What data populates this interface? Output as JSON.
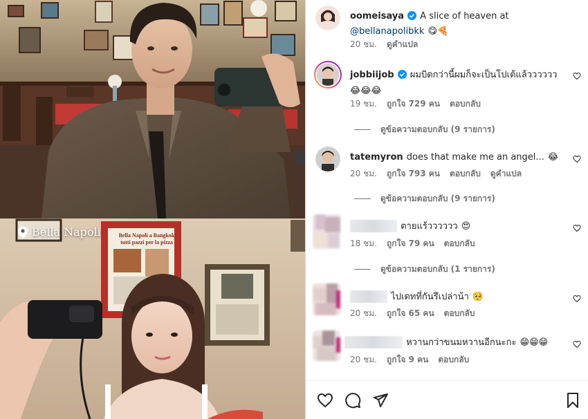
{
  "location": {
    "name": "Bella Napoli"
  },
  "poster_sign": {
    "line1": "Bella Napoli a Bangkok",
    "line2": "tutti pazzi per la pizza"
  },
  "caption": {
    "username": "oomeisaya",
    "text_prefix": "A slice of heaven at",
    "mention": "@bellanapolibkk",
    "emoji": "😋🍕",
    "time": "20 ชม.",
    "translate": "ดูคำแปล"
  },
  "comments": [
    {
      "username": "jobbiijob",
      "verified": true,
      "text": "ผมบิดกว่านี้ผมก็จะเป็นโปเต้แล้วววววว",
      "emoji": "😂😂😂",
      "time": "19 ชม.",
      "likes": "ถูกใจ 729 คน",
      "reply": "ตอบกลับ",
      "view_replies": "ดูข้อความตอบกลับ (9 รายการ)"
    },
    {
      "username": "tatemyron",
      "verified": false,
      "text": "does that make me an angel...",
      "emoji": "😂",
      "time": "20 ชม.",
      "likes": "ถูกใจ 793 คน",
      "reply": "ตอบกลับ",
      "translate": "ดูคำแปล",
      "view_replies": "ดูข้อความตอบกลับ (9 รายการ)"
    },
    {
      "username": "",
      "text": "ตายแร้วววววว",
      "emoji": "😍",
      "time": "18 ชม.",
      "likes": "ถูกใจ 79 คน",
      "reply": "ตอบกลับ",
      "view_replies": "ดูข้อความตอบกลับ (1 รายการ)"
    },
    {
      "username": "",
      "text": "ไปเดทที่กันรึเปล่าน้า",
      "emoji": "🥺",
      "time": "20 ชม.",
      "likes": "ถูกใจ 65 คน",
      "reply": "ตอบกลับ"
    },
    {
      "username": "",
      "text": "หวานกว่าขนมหวานอีกนะกะ",
      "emoji": "😁😁😁",
      "time": "20 ชม.",
      "likes": "ถูกใจ 9 คน",
      "reply": "ตอบกลับ"
    }
  ],
  "actions": {
    "icons": [
      "heart-icon",
      "comment-icon",
      "share-icon",
      "bookmark-icon"
    ]
  },
  "colors": {
    "verified": "#0095f6",
    "mention": "#00376b",
    "meta": "#737373"
  }
}
